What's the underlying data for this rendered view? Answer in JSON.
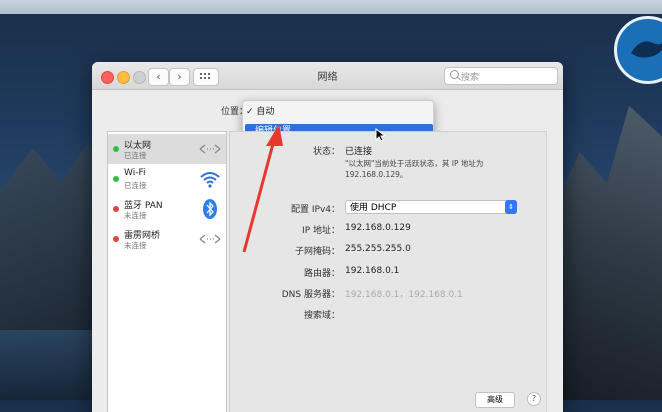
{
  "window": {
    "title": "网络"
  },
  "search": {
    "placeholder": "搜索"
  },
  "location": {
    "label": "位置：",
    "menu_items": [
      "✓ 自动",
      "编辑位置..."
    ]
  },
  "services": [
    {
      "name": "以太网",
      "status": "已连接",
      "status_color": "#2fbf43",
      "icon": "ethernet-arrows-icon"
    },
    {
      "name": "Wi-Fi",
      "status": "已连接",
      "status_color": "#2fbf43",
      "icon": "wifi-icon"
    },
    {
      "name": "蓝牙 PAN",
      "status": "未连接",
      "status_color": "#e0443d",
      "icon": "bluetooth-icon"
    },
    {
      "name": "雷雳网桥",
      "status": "未连接",
      "status_color": "#e0443d",
      "icon": "bridge-arrows-icon"
    }
  ],
  "detail": {
    "status_label": "状态：",
    "status_value": "已连接",
    "status_note": "\"以太网\"当前处于活跃状态，其 IP 地址为 192.168.0.129。",
    "config_label": "配置 IPv4：",
    "config_value": "使用 DHCP",
    "ip_label": "IP 地址：",
    "ip_value": "192.168.0.129",
    "mask_label": "子网掩码：",
    "mask_value": "255.255.255.0",
    "router_label": "路由器：",
    "router_value": "192.168.0.1",
    "dns_label": "DNS 服务器：",
    "dns_value": "192.168.0.1，192.168.0.1",
    "search_domain_label": "搜索域："
  },
  "buttons": {
    "advanced": "高级",
    "help": "?"
  },
  "colors": {
    "accent": "#2f6fd8",
    "annotation_arrow": "#e8372d"
  }
}
